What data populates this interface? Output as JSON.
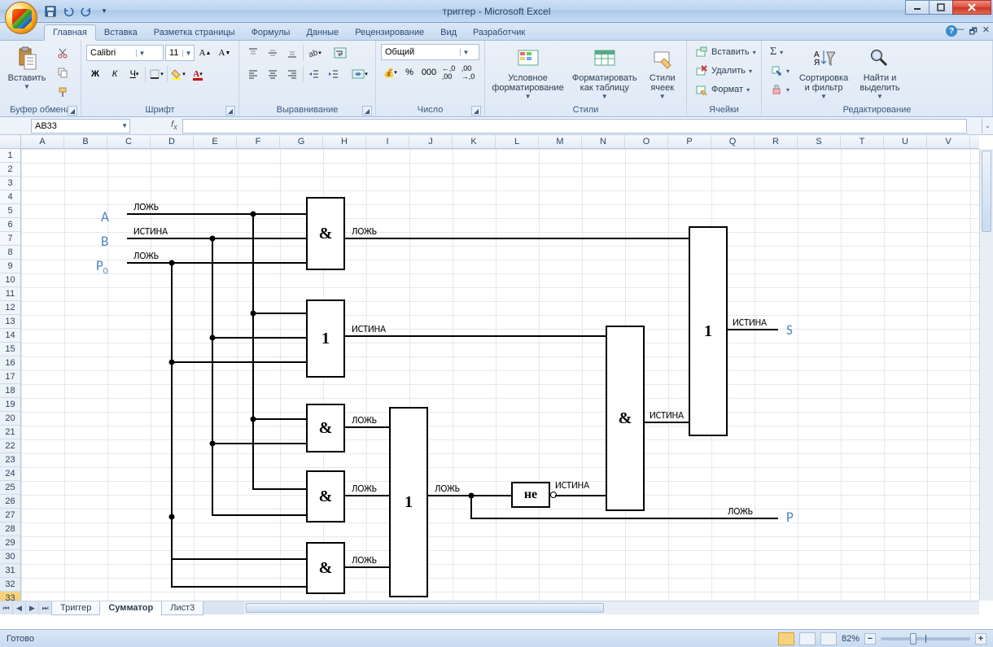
{
  "window": {
    "title": "триггер - Microsoft Excel"
  },
  "tabs": [
    "Главная",
    "Вставка",
    "Разметка страницы",
    "Формулы",
    "Данные",
    "Рецензирование",
    "Вид",
    "Разработчик"
  ],
  "activeTab": 0,
  "ribbon": {
    "clipboard": {
      "paste": "Вставить",
      "label": "Буфер обмена"
    },
    "font": {
      "name": "Calibri",
      "size": "11",
      "label": "Шрифт"
    },
    "align": {
      "label": "Выравнивание"
    },
    "number": {
      "format": "Общий",
      "label": "Число"
    },
    "styles": {
      "cond": "Условное\nформатирование",
      "astable": "Форматировать\nкак таблицу",
      "cell": "Стили\nячеек",
      "label": "Стили"
    },
    "cells": {
      "insert": "Вставить",
      "delete": "Удалить",
      "format": "Формат",
      "label": "Ячейки"
    },
    "editing": {
      "sort": "Сортировка\nи фильтр",
      "find": "Найти и\nвыделить",
      "label": "Редактирование"
    }
  },
  "namebox": "AB33",
  "columns": [
    "A",
    "B",
    "C",
    "D",
    "E",
    "F",
    "G",
    "H",
    "I",
    "J",
    "K",
    "L",
    "M",
    "N",
    "O",
    "P",
    "Q",
    "R",
    "S",
    "T",
    "U",
    "V"
  ],
  "rowCount": 33,
  "selectedRow": 33,
  "sheets": [
    "Триггер",
    "Сумматор",
    "Лист3"
  ],
  "activeSheet": 1,
  "status": {
    "ready": "Готово",
    "zoom": "82%"
  },
  "diagram": {
    "inputs": {
      "A": "A",
      "B": "B",
      "P0": "P",
      "P0sub": "0"
    },
    "outputs": {
      "S": "S",
      "P": "P"
    },
    "gates": {
      "and1": "&",
      "or1": "1",
      "and2": "&",
      "and3": "&",
      "and4": "&",
      "or2": "1",
      "not": "не",
      "and5": "&",
      "or3": "1"
    },
    "values": {
      "A": "ЛОЖЬ",
      "B": "ИСТИНА",
      "P0": "ЛОЖЬ",
      "and1": "ЛОЖЬ",
      "or1": "ИСТИНА",
      "and2": "ЛОЖЬ",
      "and3": "ЛОЖЬ",
      "and4": "ЛОЖЬ",
      "or2": "ЛОЖЬ",
      "not": "ИСТИНА",
      "and5": "ИСТИНА",
      "S": "ИСТИНА",
      "P": "ЛОЖЬ"
    }
  }
}
